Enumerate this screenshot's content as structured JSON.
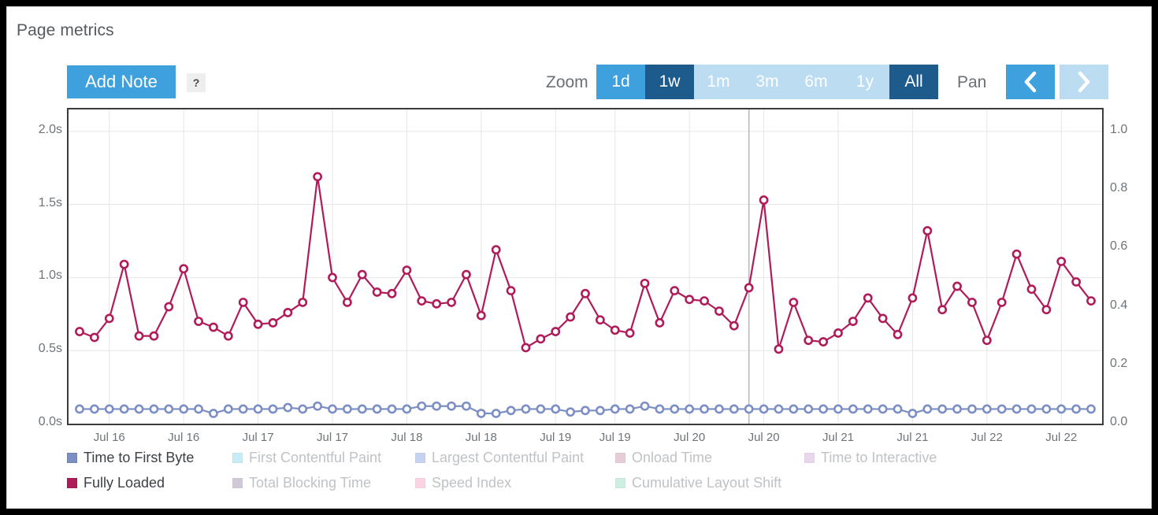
{
  "panel": {
    "title": "Page metrics"
  },
  "toolbar": {
    "add_note_label": "Add Note",
    "help_label": "?",
    "zoom_label": "Zoom",
    "pan_label": "Pan",
    "ranges": [
      {
        "label": "1d",
        "state": "hover"
      },
      {
        "label": "1w",
        "state": "on"
      },
      {
        "label": "1m",
        "state": "off"
      },
      {
        "label": "3m",
        "state": "off"
      },
      {
        "label": "6m",
        "state": "off"
      },
      {
        "label": "1y",
        "state": "off"
      },
      {
        "label": "All",
        "state": "on"
      }
    ],
    "pan_prev": {
      "icon": "chevron-left-icon",
      "enabled": true
    },
    "pan_next": {
      "icon": "chevron-right-icon",
      "enabled": false
    }
  },
  "colors": {
    "accent_blue": "#3ea0dd",
    "accent_blue_dark": "#1d5b8c",
    "accent_blue_light": "#bcdcf2",
    "ttfb": "#7b8fc4",
    "fully_loaded": "#b01b5a",
    "fcp": "#7fd6ef",
    "lcp": "#7f9fe0",
    "onload": "#c98fa5",
    "tti": "#cfa7e0",
    "tbt": "#9b8aa8",
    "speed_index": "#f79ec0",
    "cls": "#8fdcc0",
    "grid": "#e6e6e6",
    "axis": "#3b3b3b",
    "plotband": "#b9b9b9"
  },
  "legend": {
    "row1": [
      {
        "name": "Time to First Byte",
        "color": "#7b8fc4",
        "active": true
      },
      {
        "name": "First Contentful Paint",
        "color": "#7fd6ef",
        "active": false
      },
      {
        "name": "Largest Contentful Paint",
        "color": "#7f9fe0",
        "active": false
      },
      {
        "name": "Onload Time",
        "color": "#c98fa5",
        "active": false
      },
      {
        "name": "Time to Interactive",
        "color": "#cfa7e0",
        "active": false
      }
    ],
    "row2": [
      {
        "name": "Fully Loaded",
        "color": "#b01b5a",
        "active": true
      },
      {
        "name": "Total Blocking Time",
        "color": "#9b8aa8",
        "active": false
      },
      {
        "name": "Speed Index",
        "color": "#f79ec0",
        "active": false
      },
      {
        "name": "Cumulative Layout Shift",
        "color": "#8fdcc0",
        "active": false
      }
    ]
  },
  "chart_data": {
    "type": "line",
    "title": "Page metrics",
    "xlabel": "",
    "ylabel": "",
    "grid": true,
    "legend_position": "bottom",
    "y_left": {
      "label": "",
      "ticks": [
        "0.0s",
        "0.5s",
        "1.0s",
        "1.5s",
        "2.0s"
      ],
      "values": [
        0,
        0.5,
        1.0,
        1.5,
        2.0
      ],
      "min": 0,
      "max": 2.15
    },
    "y_right": {
      "label": "",
      "ticks": [
        "0.0",
        "0.2",
        "0.4",
        "0.6",
        "0.8",
        "1.0"
      ],
      "values": [
        0,
        0.2,
        0.4,
        0.6,
        0.8,
        1.0
      ],
      "min": 0,
      "max": 1.075
    },
    "x_tick_labels": [
      "Jul 16",
      "Jul 16",
      "Jul 17",
      "Jul 17",
      "Jul 18",
      "Jul 18",
      "Jul 19",
      "Jul 19",
      "Jul 20",
      "Jul 20",
      "Jul 21",
      "Jul 21",
      "Jul 22",
      "Jul 22"
    ],
    "plotband_x_index": 45,
    "series": [
      {
        "name": "Fully Loaded",
        "color": "#b01b5a",
        "axis": "left",
        "unit": "s",
        "values": [
          0.63,
          0.59,
          0.72,
          1.09,
          0.6,
          0.6,
          0.8,
          1.06,
          0.7,
          0.66,
          0.6,
          0.83,
          0.68,
          0.69,
          0.76,
          0.83,
          1.69,
          1.0,
          0.83,
          1.02,
          0.9,
          0.89,
          1.05,
          0.84,
          0.82,
          0.83,
          1.02,
          0.74,
          1.19,
          0.91,
          0.52,
          0.58,
          0.63,
          0.73,
          0.89,
          0.71,
          0.64,
          0.62,
          0.96,
          0.69,
          0.91,
          0.85,
          0.84,
          0.77,
          0.67,
          0.93,
          1.53,
          0.51,
          0.83,
          0.57,
          0.56,
          0.62,
          0.7,
          0.86,
          0.72,
          0.61,
          0.86,
          1.32,
          0.78,
          0.94,
          0.83,
          0.57,
          0.83,
          1.16,
          0.92,
          0.78,
          1.11,
          0.97,
          0.84
        ]
      },
      {
        "name": "Time to First Byte",
        "color": "#7b8fc4",
        "axis": "left",
        "unit": "s",
        "values": [
          0.1,
          0.1,
          0.1,
          0.1,
          0.1,
          0.1,
          0.1,
          0.1,
          0.1,
          0.07,
          0.1,
          0.1,
          0.1,
          0.1,
          0.11,
          0.1,
          0.12,
          0.1,
          0.1,
          0.1,
          0.1,
          0.1,
          0.1,
          0.12,
          0.12,
          0.12,
          0.12,
          0.07,
          0.07,
          0.09,
          0.1,
          0.1,
          0.1,
          0.08,
          0.09,
          0.09,
          0.1,
          0.1,
          0.12,
          0.1,
          0.1,
          0.1,
          0.1,
          0.1,
          0.1,
          0.1,
          0.1,
          0.1,
          0.1,
          0.1,
          0.1,
          0.1,
          0.1,
          0.1,
          0.1,
          0.1,
          0.07,
          0.1,
          0.1,
          0.1,
          0.1,
          0.1,
          0.1,
          0.1,
          0.1,
          0.1,
          0.1,
          0.1,
          0.1
        ]
      }
    ]
  }
}
